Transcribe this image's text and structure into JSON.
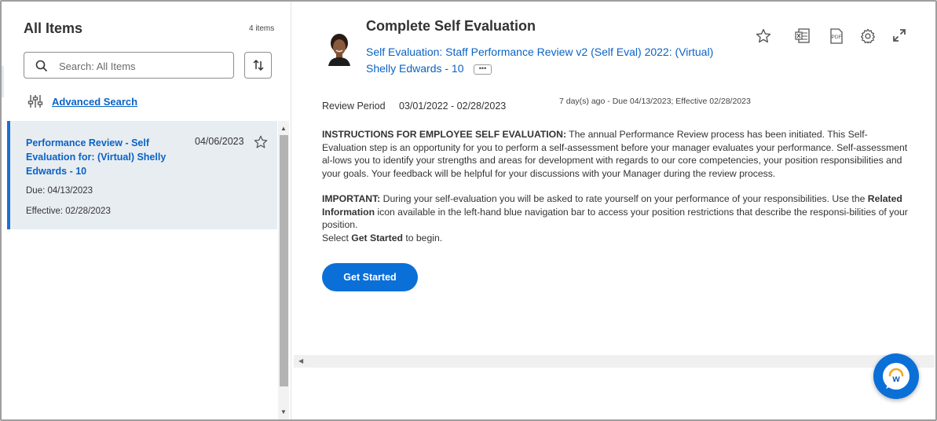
{
  "left_panel": {
    "title": "All Items",
    "item_count": "4 items",
    "search_placeholder": "Search: All Items",
    "advanced_search": "Advanced Search",
    "card": {
      "title": "Performance Review - Self Evaluation for: (Virtual) Shelly Edwards - 10",
      "date": "04/06/2023",
      "due": "Due: 04/13/2023",
      "effective": "Effective: 02/28/2023"
    }
  },
  "main": {
    "title": "Complete Self Evaluation",
    "subtitle_link": "Self Evaluation: Staff Performance Review v2 (Self Eval) 2022: (Virtual)",
    "person_link": "Shelly Edwards - 10",
    "more_label": "•••",
    "review_period_label": "Review Period",
    "review_period_value": "03/01/2022 - 02/28/2023",
    "review_meta": "7 day(s) ago - Due 04/13/2023; Effective 02/28/2023",
    "instructions_heading": "INSTRUCTIONS FOR EMPLOYEE SELF EVALUATION:",
    "instructions_text": " The annual Performance Review process has been initiated. This Self-Evaluation step is an opportunity for you to perform a self-assessment before your manager evaluates your performance. Self-assessment al-lows you to identify your strengths and areas for development with regards to our core competencies, your position responsibilities and your goals. Your feedback will be helpful for your discussions with your Manager during the review process.",
    "important_heading": "IMPORTANT:",
    "important_text_1": " During your self-evaluation you will be asked to rate yourself on your performance of your responsibilities. Use the ",
    "important_bold": "Related Information",
    "important_text_2": " icon available in the left-hand blue navigation bar to access your position restrictions that describe the responsi-bilities of your position.",
    "select_text_1": "Select ",
    "select_bold": "Get Started",
    "select_text_2": " to begin.",
    "get_started": "Get Started"
  },
  "toolbar": {
    "icons": [
      "star-icon",
      "excel-icon",
      "pdf-icon",
      "gear-icon",
      "expand-icon"
    ],
    "pdf_label": "PDF"
  },
  "chat": {
    "logo_letter": "w"
  },
  "colors": {
    "link": "#0b62c4",
    "primary": "#0b6fd8",
    "selected_bg": "#e8edf2"
  }
}
